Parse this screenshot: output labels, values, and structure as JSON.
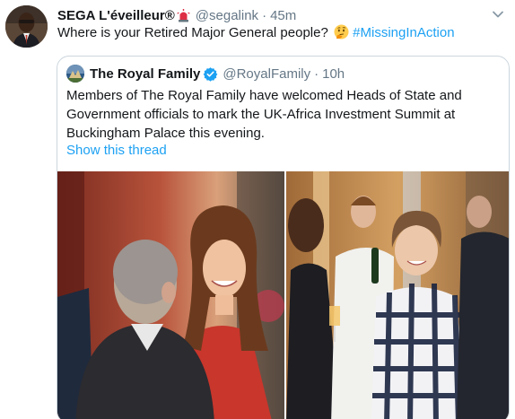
{
  "tweet": {
    "author_name": "SEGA L'éveilleur",
    "registered_mark": "®",
    "badge_icon": "police-light-emoji",
    "handle": "@segalink",
    "separator": "·",
    "time": "45m",
    "text_before": "Where is your Retired Major General people?",
    "emoji": "thinking-face-emoji",
    "hashtag": "#MissingInAction",
    "menu_icon": "chevron-down-icon"
  },
  "quoted": {
    "author_name": "The Royal Family",
    "verified_icon": "verified-badge-icon",
    "handle": "@RoyalFamily",
    "separator": "·",
    "time": "10h",
    "text_lines": [
      "Members of The Royal Family have welcomed Heads of State and",
      "Government officials to mark the UK-Africa Investment Summit at",
      "Buckingham Palace this evening."
    ],
    "show_thread": "Show this thread"
  },
  "colors": {
    "link": "#1da1f2",
    "secondary_text": "#657786",
    "border": "#ccd6dd"
  }
}
